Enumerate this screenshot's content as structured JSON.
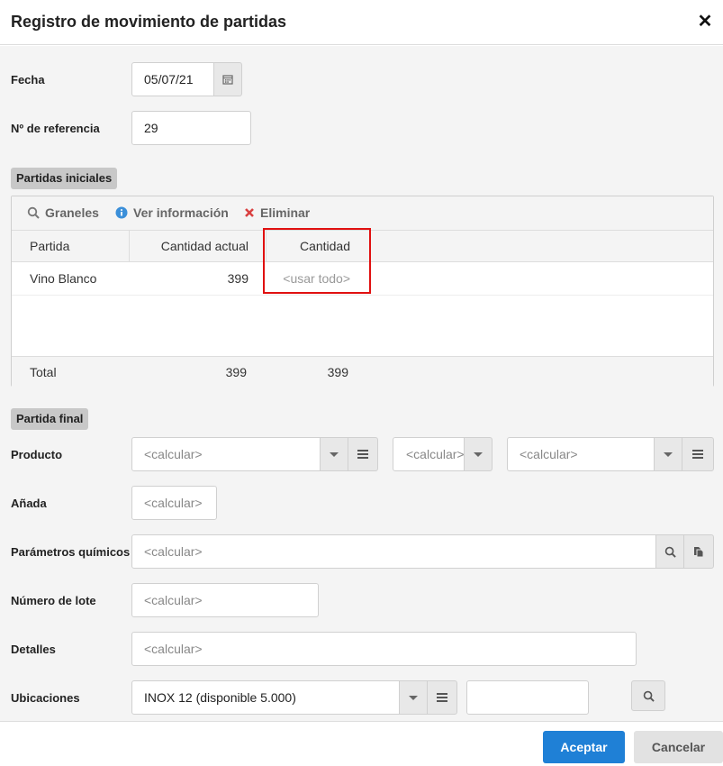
{
  "dialog": {
    "title": "Registro de movimiento de partidas",
    "close_glyph": "✕"
  },
  "fields": {
    "fecha": {
      "label": "Fecha",
      "value": "05/07/21"
    },
    "referencia": {
      "label": "Nº de referencia",
      "value": "29"
    }
  },
  "initial_section": {
    "tag": "Partidas iniciales",
    "toolbar": {
      "graneles": "Graneles",
      "ver_info": "Ver información",
      "eliminar": "Eliminar"
    },
    "columns": [
      "Partida",
      "Cantidad actual",
      "Cantidad"
    ],
    "rows": [
      {
        "partida": "Vino Blanco",
        "cantidad_actual": "399",
        "cantidad": "<usar todo>"
      }
    ],
    "footer": {
      "label": "Total",
      "cantidad_actual": "399",
      "cantidad": "399"
    }
  },
  "final_section": {
    "tag": "Partida final",
    "producto": {
      "label": "Producto",
      "value1": "<calcular>",
      "value2": "<calcular>",
      "value3": "<calcular>"
    },
    "anada": {
      "label": "Añada",
      "value": "<calcular>"
    },
    "parametros": {
      "label": "Parámetros químicos",
      "value": "<calcular>"
    },
    "lote": {
      "label": "Número de lote",
      "value": "<calcular>"
    },
    "detalles": {
      "label": "Detalles",
      "value": "<calcular>"
    },
    "ubicaciones": {
      "label": "Ubicaciones",
      "value": "INOX 12 (disponible 5.000)",
      "extra_value": ""
    }
  },
  "buttons": {
    "accept": "Aceptar",
    "cancel": "Cancelar"
  },
  "colors": {
    "accent": "#1f80d6",
    "highlight_box": "#e01010",
    "info_icon": "#3b8fd9",
    "delete_icon": "#d94040"
  }
}
